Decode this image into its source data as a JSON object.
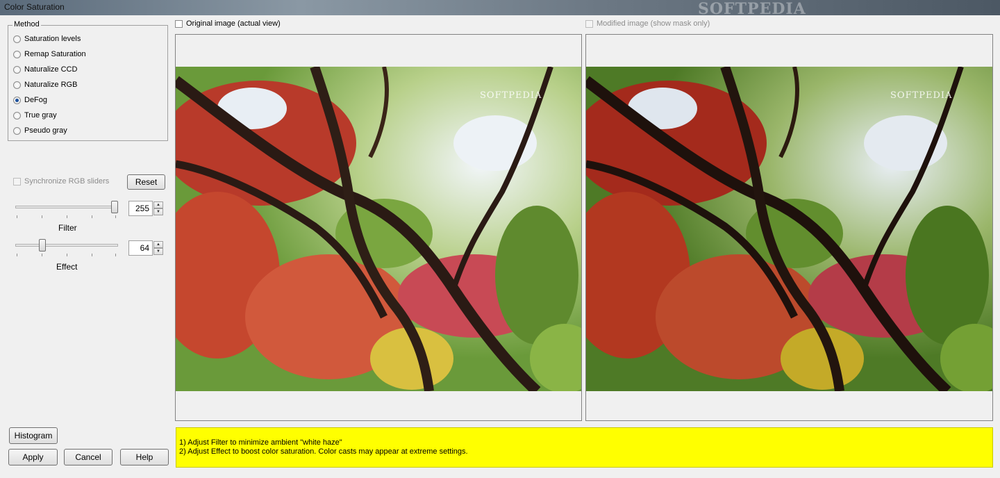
{
  "window": {
    "title": "Color Saturation",
    "watermark": "SOFTPEDIA"
  },
  "method": {
    "legend": "Method",
    "options": [
      {
        "label": "Saturation levels",
        "selected": false
      },
      {
        "label": "Remap Saturation",
        "selected": false
      },
      {
        "label": "Naturalize CCD",
        "selected": false
      },
      {
        "label": "Naturalize RGB",
        "selected": false
      },
      {
        "label": "DeFog",
        "selected": true
      },
      {
        "label": "True gray",
        "selected": false
      },
      {
        "label": "Pseudo gray",
        "selected": false
      }
    ]
  },
  "sync": {
    "label": "Synchronize RGB sliders",
    "checked": false,
    "enabled": false
  },
  "reset_label": "Reset",
  "sliders": [
    {
      "label": "Filter",
      "value": "255",
      "level": 1.0
    },
    {
      "label": "Effect",
      "value": "64",
      "level": 0.25
    }
  ],
  "panes": {
    "original": {
      "checkbox_label": "Original image (actual view)",
      "checked": false
    },
    "modified": {
      "checkbox_label": "Modified image (show mask only)",
      "checked": false,
      "enabled": false
    },
    "image_watermark": "SOFTPEDIA"
  },
  "buttons": {
    "histogram": "Histogram",
    "apply": "Apply",
    "cancel": "Cancel",
    "help": "Help"
  },
  "hints": [
    "1) Adjust Filter to minimize ambient \"white haze\"",
    "2) Adjust Effect to boost color saturation. Color casts may appear at extreme settings."
  ]
}
